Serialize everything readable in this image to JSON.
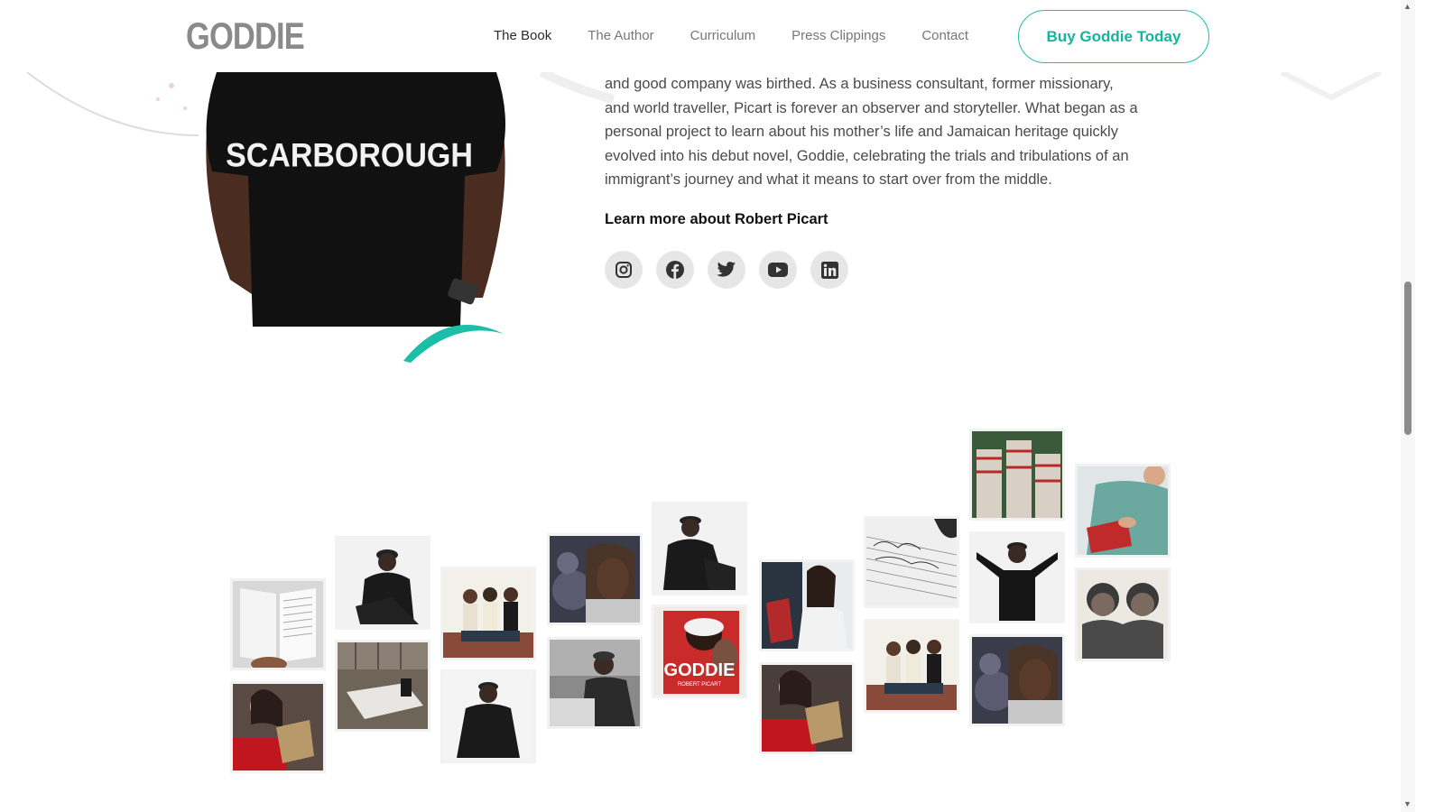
{
  "header": {
    "logo": "GODDIE",
    "nav": [
      {
        "label": "The Book",
        "active": true
      },
      {
        "label": "The Author",
        "active": false
      },
      {
        "label": "Curriculum",
        "active": false
      },
      {
        "label": "Press Clippings",
        "active": false
      },
      {
        "label": "Contact",
        "active": false
      }
    ],
    "cta_label": "Buy Goddie Today"
  },
  "author": {
    "shirt_text": "SCARBOROUGH",
    "bio_lines": [
      "and good company was birthed. As a business consultant, former missionary,",
      "and world traveller, Picart is forever an observer and storyteller. What began as a",
      "personal project to learn about his mother’s life and Jamaican heritage quickly",
      "evolved into his debut novel, Goddie, celebrating the trials and tribulations of an",
      "immigrant’s journey and what it means to start over from the middle."
    ],
    "learn_more": "Learn more about Robert Picart",
    "socials": [
      "instagram-icon",
      "facebook-icon",
      "twitter-icon",
      "youtube-icon",
      "linkedin-icon"
    ]
  },
  "gallery": {
    "book_cover_title": "GODDIE",
    "book_cover_author": "ROBERT PICART"
  },
  "colors": {
    "accent": "#1bbfa8",
    "logo": "#8a8a8a",
    "shirt": "#111111"
  }
}
